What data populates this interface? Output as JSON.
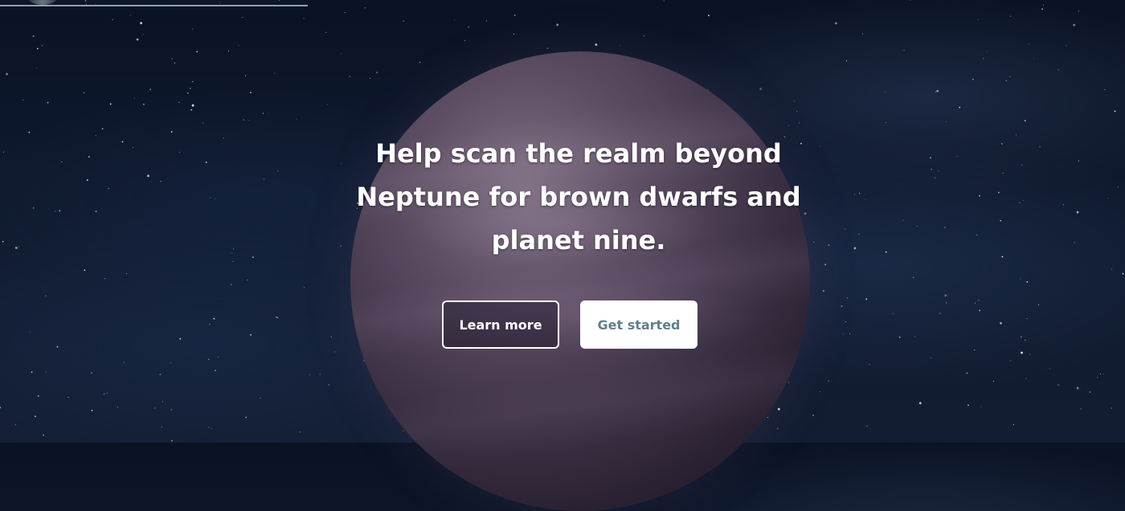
{
  "hero": {
    "headline_lines": [
      "Help scan the realm beyond",
      "Neptune for brown dwarfs and",
      "planet nine."
    ]
  },
  "buttons": {
    "learn_more": "Learn more",
    "get_started": "Get started"
  },
  "colors": {
    "primary_text": "#ffffff",
    "get_started_text": "#5f7f8c",
    "top_bar_line": "#8fa3ad"
  }
}
